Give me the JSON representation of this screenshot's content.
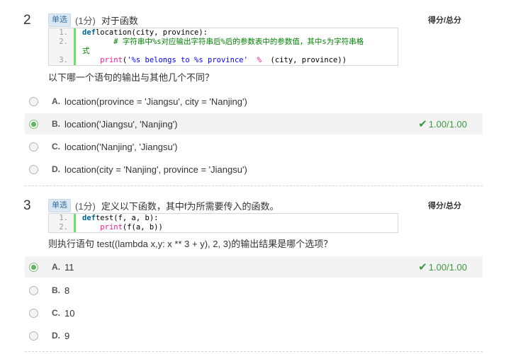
{
  "questions": [
    {
      "number": "2",
      "type": "单选",
      "score": "(1分)",
      "title": "对于函数",
      "total_label": "得分/总分",
      "code": [
        {
          "ln": "1.",
          "parts": [
            [
              "kw",
              "def"
            ],
            [
              "",
              "location(city, province):"
            ]
          ]
        },
        {
          "ln": "2.",
          "parts": [
            [
              "",
              "       "
            ],
            [
              "cm",
              "# 字符串中%s对应输出字符串后%后的参数表中的参数值，其中s为字符串格"
            ]
          ]
        },
        {
          "ln": "",
          "parts": [
            [
              "cm",
              "式"
            ]
          ]
        },
        {
          "ln": "3.",
          "parts": [
            [
              "",
              "    "
            ],
            [
              "fn",
              "print"
            ],
            [
              "",
              "("
            ],
            [
              "st",
              "'%s belongs to %s province'"
            ],
            [
              "",
              "  "
            ],
            [
              "op",
              "%"
            ],
            [
              "",
              "  (city, province))"
            ]
          ]
        }
      ],
      "prompt": "以下哪一个语句的输出与其他几个不同？",
      "options": [
        {
          "letter": "A.",
          "text": "location(province = 'Jiangsu', city = 'Nanjing')",
          "checked": false,
          "result": ""
        },
        {
          "letter": "B.",
          "text": "location('Jiangsu', 'Nanjing')",
          "checked": true,
          "result": "1.00/1.00"
        },
        {
          "letter": "C.",
          "text": "location('Nanjing', 'Jiangsu')",
          "checked": false,
          "result": ""
        },
        {
          "letter": "D.",
          "text": "location(city = 'Nanjing', province = 'Jiangsu')",
          "checked": false,
          "result": ""
        }
      ]
    },
    {
      "number": "3",
      "type": "单选",
      "score": "(1分)",
      "title": "定义以下函数，其中f为所需要传入的函数。",
      "total_label": "得分/总分",
      "code": [
        {
          "ln": "1.",
          "parts": [
            [
              "kw",
              "def"
            ],
            [
              "",
              "test(f, a, b):"
            ]
          ]
        },
        {
          "ln": "2.",
          "parts": [
            [
              "",
              "    "
            ],
            [
              "fn",
              "print"
            ],
            [
              "",
              "(f(a, b))"
            ]
          ]
        }
      ],
      "prompt": "则执行语句 test((lambda x,y: x ** 3 + y), 2, 3)的输出结果是哪个选项？",
      "options": [
        {
          "letter": "A.",
          "text": "11",
          "checked": true,
          "result": "1.00/1.00"
        },
        {
          "letter": "B.",
          "text": "8",
          "checked": false,
          "result": ""
        },
        {
          "letter": "C.",
          "text": "10",
          "checked": false,
          "result": ""
        },
        {
          "letter": "D.",
          "text": "9",
          "checked": false,
          "result": ""
        }
      ]
    }
  ],
  "icons": {
    "correct": "check-icon",
    "radio": "radio-icon"
  },
  "colors": {
    "correct": "#3c9a3c",
    "selected_bg": "#f3f3f3",
    "tag_bg": "#dbe8f4"
  }
}
